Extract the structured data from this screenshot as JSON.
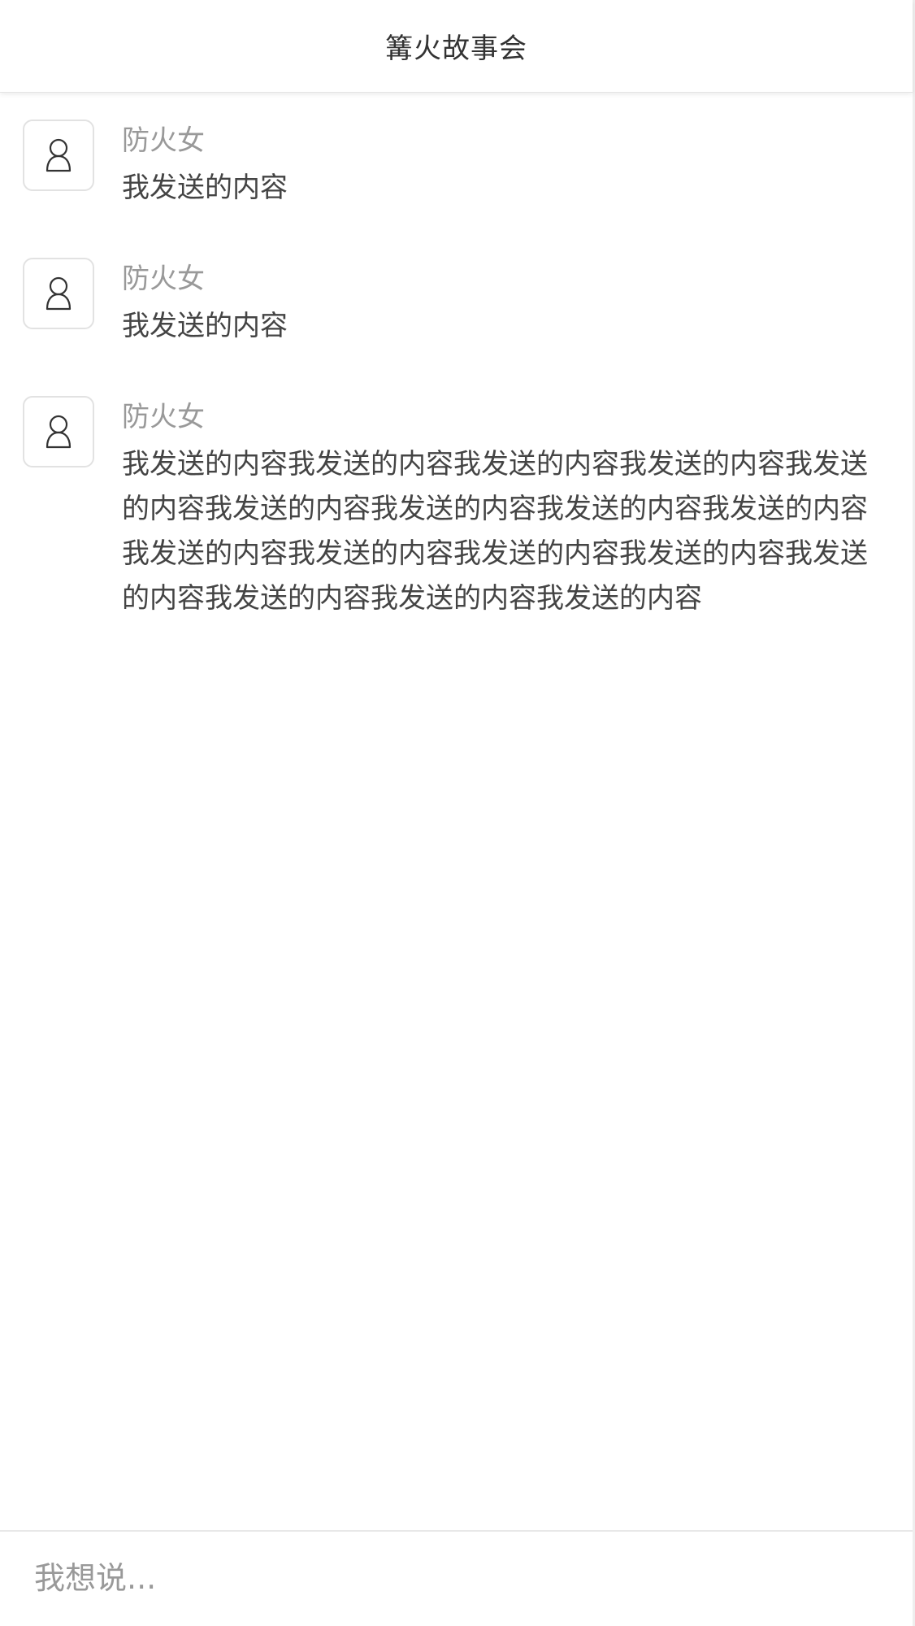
{
  "header": {
    "title": "篝火故事会"
  },
  "messages": [
    {
      "name": "防火女",
      "text": "我发送的内容",
      "avatar_icon": "user-icon"
    },
    {
      "name": "防火女",
      "text": "我发送的内容",
      "avatar_icon": "user-icon"
    },
    {
      "name": "防火女",
      "text": "我发送的内容我发送的内容我发送的内容我发送的内容我发送的内容我发送的内容我发送的内容我发送的内容我发送的内容我发送的内容我发送的内容我发送的内容我发送的内容我发送的内容我发送的内容我发送的内容我发送的内容",
      "avatar_icon": "user-icon"
    }
  ],
  "composer": {
    "placeholder": "我想说...",
    "value": ""
  },
  "colors": {
    "name_text": "#999999",
    "message_text": "#444444",
    "title_text": "#333333",
    "border": "#e2e2e2"
  }
}
